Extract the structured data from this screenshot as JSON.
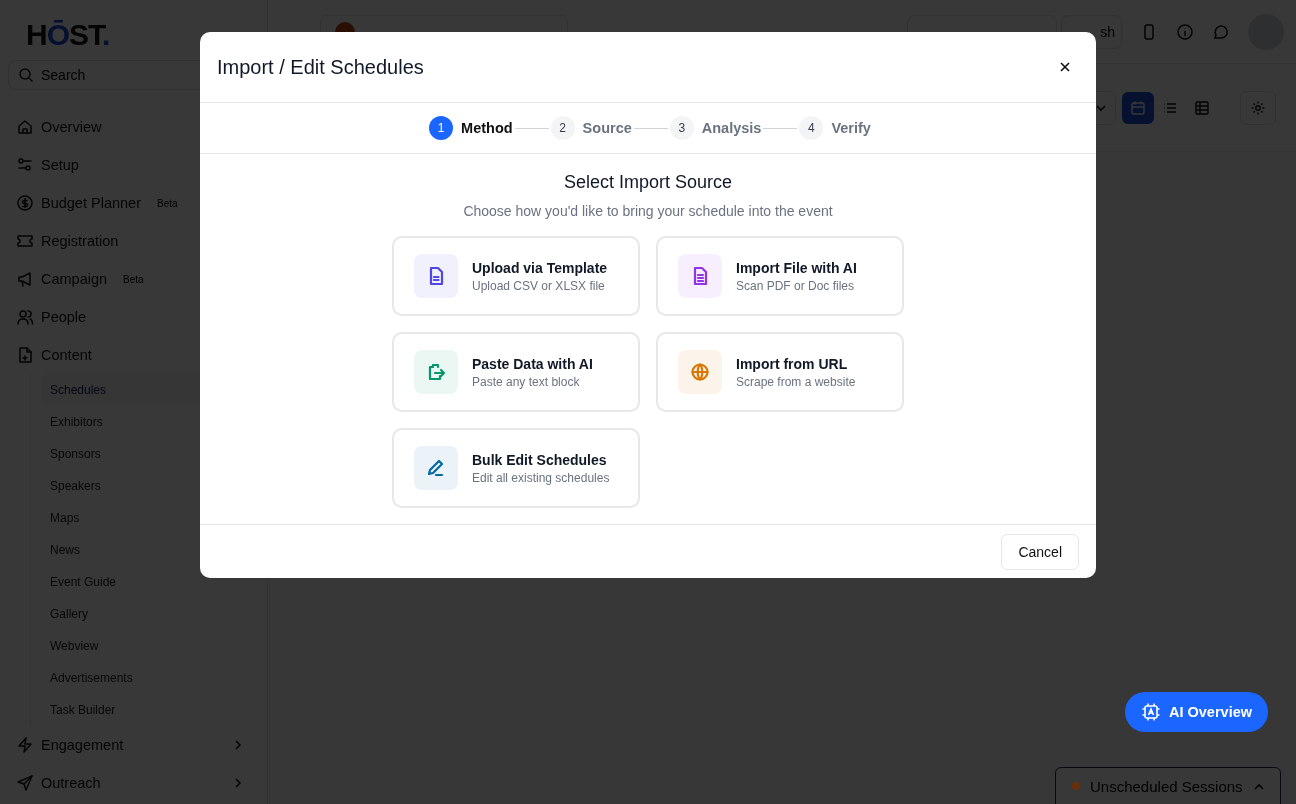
{
  "sidebar": {
    "logo": [
      {
        "text": "H",
        "accent": false
      },
      {
        "text": "Ō",
        "accent": true
      },
      {
        "text": "ST",
        "accent": false
      },
      {
        "text": ".",
        "accent": true
      }
    ],
    "search": {
      "placeholder": "Search"
    },
    "items": [
      {
        "label": "Overview",
        "kind": "link"
      },
      {
        "label": "Setup",
        "kind": "link"
      },
      {
        "label": "Budget Planner",
        "kind": "link",
        "badge": "Beta"
      },
      {
        "label": "Registration",
        "kind": "link"
      },
      {
        "label": "Campaign",
        "kind": "link",
        "badge": "Beta"
      },
      {
        "label": "People",
        "kind": "link"
      },
      {
        "label": "Content",
        "kind": "group",
        "expanded": true,
        "children": [
          {
            "label": "Schedules",
            "selected": true
          },
          {
            "label": "Exhibitors",
            "selected": false
          },
          {
            "label": "Sponsors",
            "selected": false
          },
          {
            "label": "Speakers",
            "selected": false
          },
          {
            "label": "Maps",
            "selected": false
          },
          {
            "label": "News",
            "selected": false
          },
          {
            "label": "Event Guide",
            "selected": false
          },
          {
            "label": "Gallery",
            "selected": false
          },
          {
            "label": "Webview",
            "selected": false
          },
          {
            "label": "Advertisements",
            "selected": false
          },
          {
            "label": "Task Builder",
            "selected": false
          }
        ]
      },
      {
        "label": "Engagement",
        "kind": "group",
        "expanded": false
      },
      {
        "label": "Outreach",
        "kind": "group",
        "expanded": false
      }
    ]
  },
  "topbar": {
    "partial_button": "sh"
  },
  "view_buttons": [
    {
      "selected": true
    },
    {
      "selected": false
    },
    {
      "selected": false
    }
  ],
  "dialog": {
    "title": "Import / Edit Schedules",
    "steps": [
      {
        "number": "1",
        "label": "Method",
        "selected": true
      },
      {
        "number": "2",
        "label": "Source",
        "selected": false
      },
      {
        "number": "3",
        "label": "Analysis",
        "selected": false
      },
      {
        "number": "4",
        "label": "Verify",
        "selected": false
      }
    ],
    "heading": "Select Import Source",
    "subheading": "Choose how you'd like to bring your schedule into the event",
    "options": [
      {
        "title": "Upload via Template",
        "subtitle": "Upload CSV or XLSX file",
        "color": "#4f46e5"
      },
      {
        "title": "Import File with AI",
        "subtitle": "Scan PDF or Doc files",
        "color": "#9333ea"
      },
      {
        "title": "Paste Data with AI",
        "subtitle": "Paste any text block",
        "color": "#059669"
      },
      {
        "title": "Import from URL",
        "subtitle": "Scrape from a website",
        "color": "#d97706"
      },
      {
        "title": "Bulk Edit Schedules",
        "subtitle": "Edit all existing schedules",
        "color": "#0369a1"
      }
    ],
    "cancel": "Cancel"
  },
  "ai_button": "AI Overview",
  "unscheduled": {
    "label": "Unscheduled Sessions",
    "color": "#6b2f08"
  }
}
